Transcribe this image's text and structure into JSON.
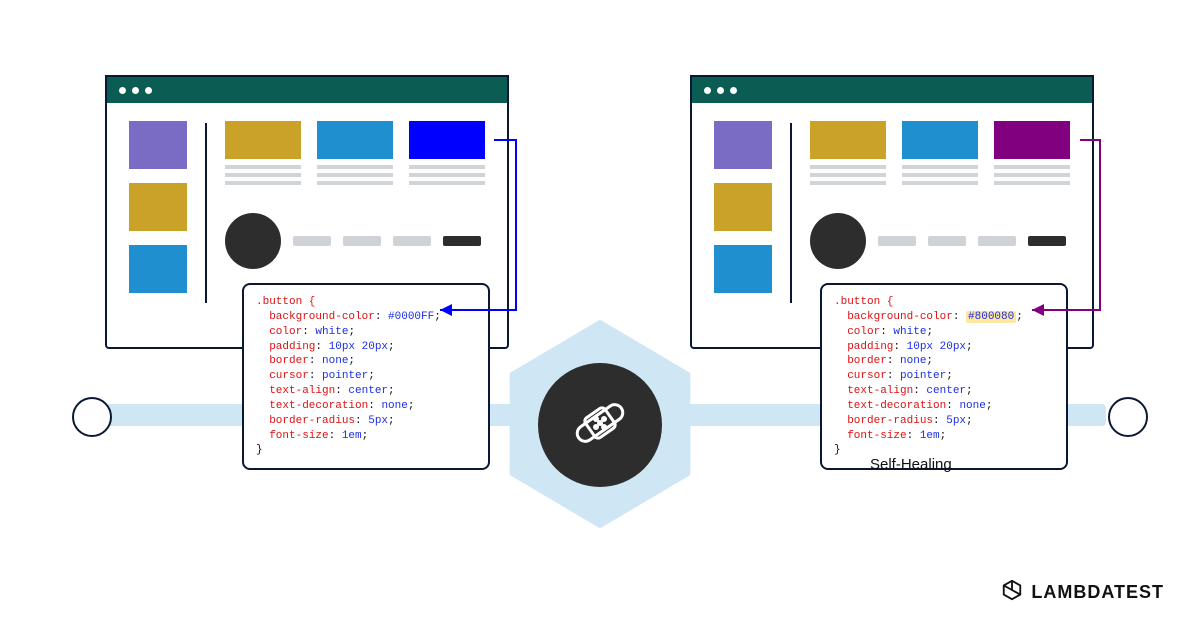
{
  "caption": "Self-Healing",
  "logo_text": "LAMBDATEST",
  "left": {
    "target_color": "#0000FF",
    "css": {
      "selector": ".button {",
      "lines": [
        {
          "prop": "background-color",
          "val": "#0000FF",
          "hl": false
        },
        {
          "prop": "color",
          "val": "white",
          "hl": false
        },
        {
          "prop": "padding",
          "val": "10px 20px",
          "hl": false
        },
        {
          "prop": "border",
          "val": "none",
          "hl": false
        },
        {
          "prop": "cursor",
          "val": "pointer",
          "hl": false
        },
        {
          "prop": "text-align",
          "val": "center",
          "hl": false
        },
        {
          "prop": "text-decoration",
          "val": "none",
          "hl": false
        },
        {
          "prop": "border-radius",
          "val": "5px",
          "hl": false
        },
        {
          "prop": "font-size",
          "val": "1em",
          "hl": false
        }
      ],
      "close": "}"
    }
  },
  "right": {
    "target_color": "#800080",
    "css": {
      "selector": ".button {",
      "lines": [
        {
          "prop": "background-color",
          "val": "#800080",
          "hl": true
        },
        {
          "prop": "color",
          "val": "white",
          "hl": false
        },
        {
          "prop": "padding",
          "val": "10px 20px",
          "hl": false
        },
        {
          "prop": "border",
          "val": "none",
          "hl": false
        },
        {
          "prop": "cursor",
          "val": "pointer",
          "hl": false
        },
        {
          "prop": "text-align",
          "val": "center",
          "hl": false
        },
        {
          "prop": "text-decoration",
          "val": "none",
          "hl": false
        },
        {
          "prop": "border-radius",
          "val": "5px",
          "hl": false
        },
        {
          "prop": "font-size",
          "val": "1em",
          "hl": false
        }
      ],
      "close": "}"
    }
  }
}
